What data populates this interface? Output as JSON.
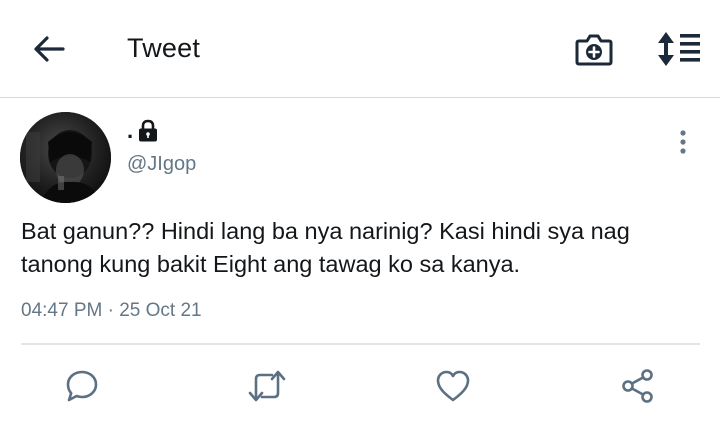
{
  "header": {
    "title": "Tweet",
    "back_icon": "arrow-left-icon",
    "camera_icon": "camera-plus-icon",
    "sort_icon": "sort-list-icon"
  },
  "tweet": {
    "display_name": ".",
    "protected_icon": "lock-icon",
    "handle": "@JIgop",
    "text": "Bat ganun?? Hindi lang ba nya narinig? Kasi hindi sya nag tanong kung bakit Eight ang tawag ko sa kanya.",
    "time": "04:47 PM",
    "separator": "·",
    "date": "25 Oct 21",
    "more_icon": "more-vertical-icon"
  },
  "actions": {
    "reply_icon": "reply-icon",
    "retweet_icon": "retweet-icon",
    "like_icon": "heart-icon",
    "share_icon": "share-icon"
  },
  "colors": {
    "text": "#14171a",
    "secondary": "#657786",
    "icon": "#1c2938",
    "action_icon": "#5b7083",
    "divider": "#e1e4e8"
  }
}
